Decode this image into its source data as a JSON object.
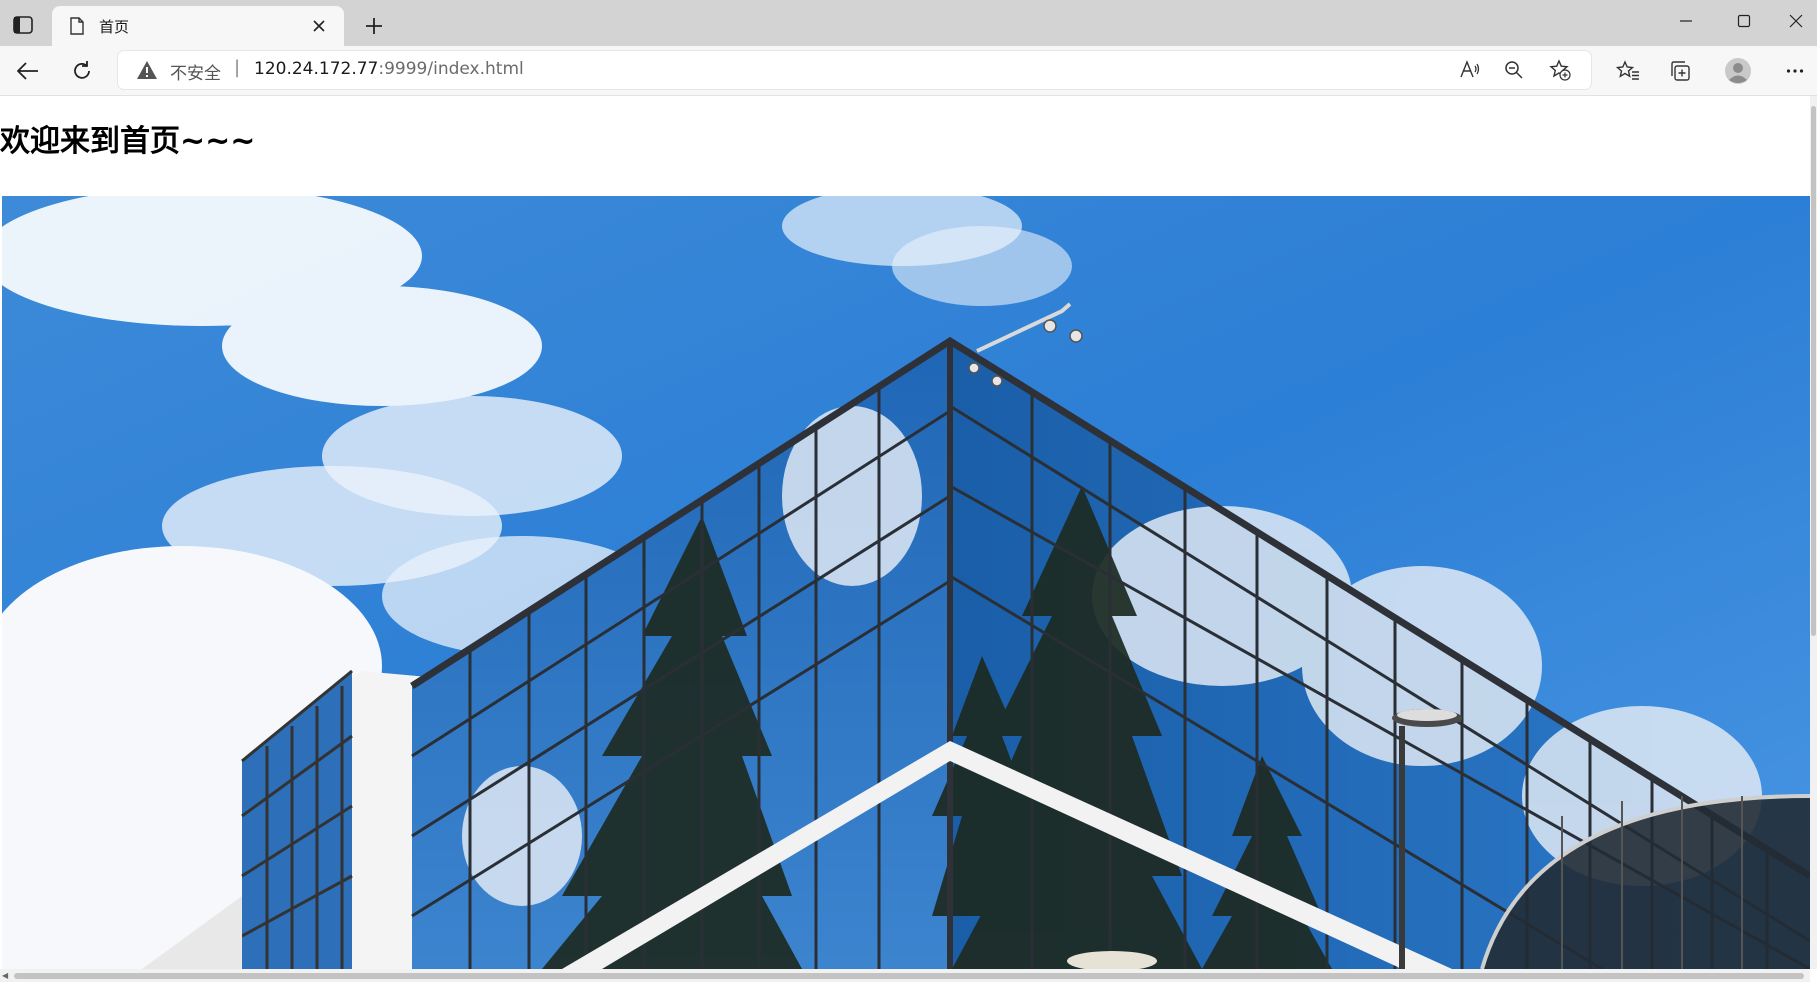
{
  "tab": {
    "title": "首页",
    "icon": "document-icon"
  },
  "address_bar": {
    "security_label": "不安全",
    "separator": "|",
    "url_host": "120.24.172.77",
    "url_path": ":9999/index.html"
  },
  "page": {
    "heading": "欢迎来到首页~~~",
    "hero_image": "glass-office-building-photo"
  },
  "colors": {
    "tabbar_bg": "#d3d3d3",
    "toolbar_bg": "#f7f7f7",
    "sky_blue": "#2f7fd4"
  }
}
